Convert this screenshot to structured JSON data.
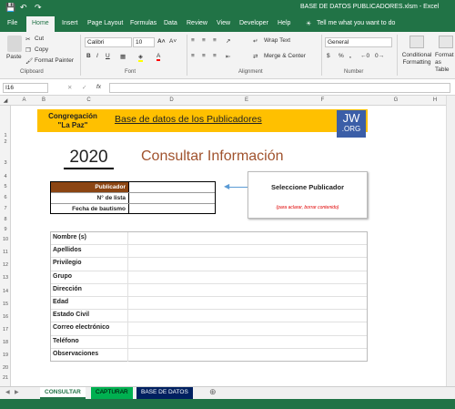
{
  "window": {
    "title": "BASE DE DATOS PUBLICADORES.xlsm - Excel"
  },
  "ribbon_tabs": [
    "File",
    "Home",
    "Insert",
    "Page Layout",
    "Formulas",
    "Data",
    "Review",
    "View",
    "Developer",
    "Help"
  ],
  "tell_me": "Tell me what you want to do",
  "clipboard": {
    "paste": "Paste",
    "cut": "Cut",
    "copy": "Copy",
    "format_painter": "Format Painter",
    "group": "Clipboard"
  },
  "font": {
    "name": "Calibri",
    "size": "10",
    "group": "Font"
  },
  "alignment": {
    "wrap": "Wrap Text",
    "merge": "Merge & Center",
    "group": "Alignment"
  },
  "number": {
    "format": "General",
    "group": "Number"
  },
  "styles": {
    "conditional": "Conditional Formatting",
    "format_table": "Format as Table"
  },
  "formula_bar": {
    "name_box": "I16",
    "fx": "fx",
    "value": ""
  },
  "columns": [
    "A",
    "B",
    "C",
    "D",
    "E",
    "F",
    "G",
    "H"
  ],
  "rows": [
    "1",
    "2",
    "3",
    "4",
    "5",
    "6",
    "7",
    "8",
    "9",
    "10",
    "11",
    "12",
    "13",
    "14",
    "15",
    "16",
    "17",
    "18",
    "19",
    "20",
    "21"
  ],
  "banner": {
    "congregation_line1": "Congregación",
    "congregation_line2": "\"La Paz\"",
    "title": "Base de datos de los Publicadores",
    "logo_top": "JW",
    "logo_bottom": ".ORG"
  },
  "year": "2020",
  "heading": "Consultar Información",
  "lookup": {
    "publicador": "Publicador",
    "num_lista": "N° de lista",
    "fecha": "Fecha de bautismo"
  },
  "selector": {
    "title": "Seleccione Publicador",
    "hint": "(para aclarar, borrar contenido)"
  },
  "fields": [
    "Nombre (s)",
    "Apellidos",
    "Privilegio",
    "Grupo",
    "Dirección",
    "Edad",
    "Estado Civil",
    "Correo electrónico",
    "Teléfono",
    "Observaciones"
  ],
  "sheet_tabs": [
    "CONSULTAR",
    "CAPTURAR",
    "BASE DE DATOS"
  ],
  "colors": {
    "excel_green": "#217346",
    "banner": "#ffc000",
    "publicador_label": "#8b4513",
    "heading": "#a0522d",
    "jw_blue": "#3b5ea7"
  }
}
